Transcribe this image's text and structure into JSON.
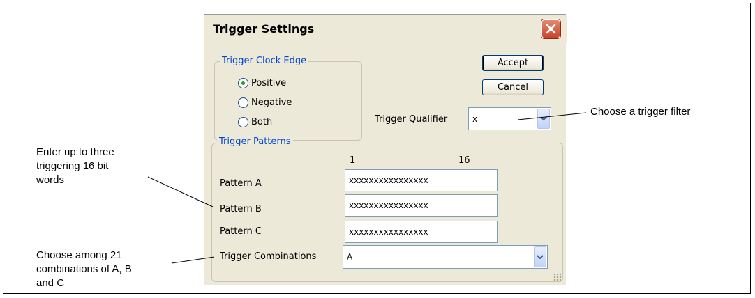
{
  "dialog": {
    "title": "Trigger Settings",
    "clock_edge": {
      "legend": "Trigger Clock Edge",
      "options": [
        {
          "label": "Positive",
          "checked": true
        },
        {
          "label": "Negative",
          "checked": false
        },
        {
          "label": "Both",
          "checked": false
        }
      ]
    },
    "buttons": {
      "accept": "Accept",
      "cancel": "Cancel"
    },
    "qualifier": {
      "label": "Trigger Qualifier",
      "value": "x"
    },
    "patterns": {
      "legend": "Trigger Patterns",
      "scale_start": "1",
      "scale_end": "16",
      "rows": [
        {
          "label": "Pattern A",
          "value": "xxxxxxxxxxxxxxxx"
        },
        {
          "label": "Pattern B",
          "value": "xxxxxxxxxxxxxxxx"
        },
        {
          "label": "Pattern C",
          "value": "xxxxxxxxxxxxxxxx"
        }
      ],
      "combinations": {
        "label": "Trigger Combinations",
        "value": "A"
      }
    }
  },
  "annotations": {
    "filter": "Choose a trigger filter",
    "patterns": [
      "Enter up to three",
      "triggering 16 bit",
      "words"
    ],
    "combinations": [
      "Choose among 21",
      "combinations of A, B",
      "and C"
    ]
  }
}
